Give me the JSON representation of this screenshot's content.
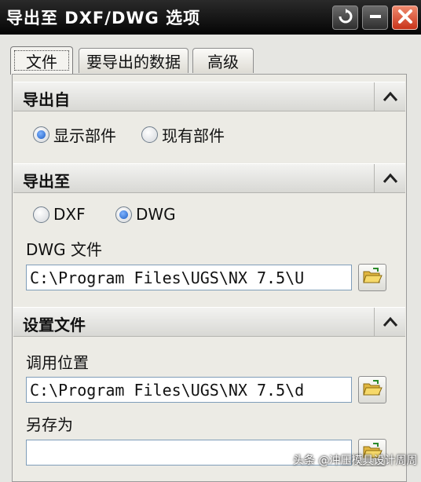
{
  "window": {
    "title": "导出至 DXF/DWG 选项",
    "buttons": {
      "reset_icon": "reset-icon",
      "minimize_icon": "minimize-icon",
      "close_icon": "close-icon"
    }
  },
  "tabs": [
    {
      "label": "文件",
      "active": true
    },
    {
      "label": "要导出的数据",
      "active": false
    },
    {
      "label": "高级",
      "active": false
    }
  ],
  "sections": {
    "export_from": {
      "title": "导出自",
      "options": [
        {
          "label": "显示部件",
          "selected": true
        },
        {
          "label": "现有部件",
          "selected": false
        }
      ]
    },
    "export_to": {
      "title": "导出至",
      "options": [
        {
          "label": "DXF",
          "selected": false
        },
        {
          "label": "DWG",
          "selected": true
        }
      ],
      "file_label": "DWG 文件",
      "file_value": "C:\\Program Files\\UGS\\NX 7.5\\U"
    },
    "settings_file": {
      "title": "设置文件",
      "load_label": "调用位置",
      "load_value": "C:\\Program Files\\UGS\\NX 7.5\\d",
      "save_as_label": "另存为",
      "save_as_value": ""
    }
  },
  "watermark": "头条 @冲压模具设计周周",
  "colors": {
    "titlebar": "#0a0a0a",
    "close_button": "#d9472b",
    "radio_selected": "#1f5fc4"
  }
}
